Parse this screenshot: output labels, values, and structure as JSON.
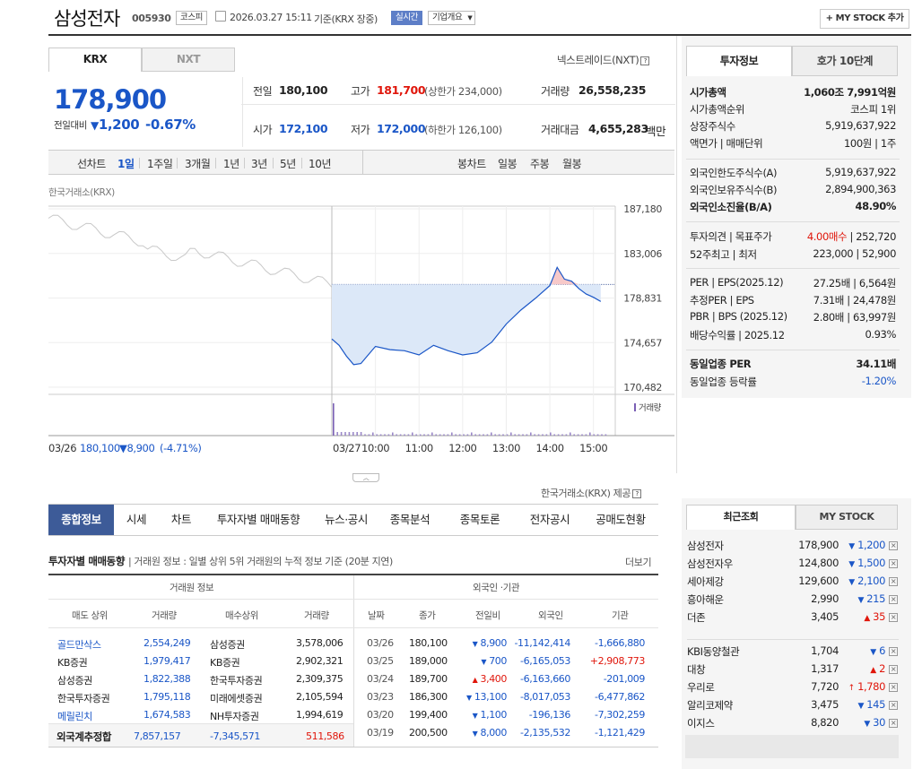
{
  "header": {
    "title": "삼성전자",
    "code": "005930",
    "market_badge": "코스피",
    "datetime": "2026.03.27 15:11",
    "basis": "기준(KRX 장중)",
    "realtime_badge": "실시간",
    "company_overview": "기업개요",
    "my_stock_btn": "+ MY STOCK 추가"
  },
  "market_tabs": {
    "krx": "KRX",
    "nxt": "NXT",
    "nextrade_link": "넥스트레이드(NXT)"
  },
  "quote": {
    "price": "178,900",
    "change_label": "전일대비",
    "change": "1,200",
    "change_pct": "-0.67%",
    "prev_close_label": "전일",
    "prev_close": "180,100",
    "high_label": "고가",
    "high": "181,700",
    "upper_limit": "(상한가 234,000)",
    "volume_label": "거래량",
    "volume": "26,558,235",
    "open_label": "시가",
    "open": "172,100",
    "low_label": "저가",
    "low": "172,000",
    "lower_limit": "(하한가 126,100)",
    "amount_label": "거래대금",
    "amount": "4,655,283",
    "amount_unit": "백만"
  },
  "period_bar": {
    "line_chart": "선차트",
    "periods": [
      "1일",
      "1주일",
      "3개월",
      "1년",
      "3년",
      "5년",
      "10년"
    ],
    "candle_chart": "봉차트",
    "candle_periods": [
      "일봉",
      "주봉",
      "월봉"
    ]
  },
  "chart_data": {
    "type": "line",
    "source_label": "한국거래소(KRX)",
    "y_ticks": [
      "187,180",
      "183,006",
      "178,831",
      "174,657",
      "170,482"
    ],
    "ylim": [
      170482,
      187180
    ],
    "prev_close_ref": 180100,
    "volume_label": "거래량",
    "x_ticks": [
      "03/27",
      "10:00",
      "11:00",
      "12:00",
      "13:00",
      "14:00",
      "15:00"
    ],
    "prev_day_label": "03/26",
    "prev_day_summary": "180,100",
    "prev_day_change": "8,900",
    "prev_day_pct": "(-4.71%)",
    "series": [
      {
        "x": [
          "09:00",
          "09:10",
          "09:20",
          "09:30",
          "09:40",
          "09:50",
          "10:00",
          "10:20",
          "10:40",
          "11:00",
          "11:20",
          "11:40",
          "12:00",
          "12:20",
          "12:40",
          "13:00",
          "13:20",
          "13:40",
          "14:00",
          "14:10",
          "14:20",
          "14:30",
          "14:40",
          "14:50",
          "15:00",
          "15:10"
        ],
        "y": [
          175000,
          174400,
          173400,
          172600,
          172700,
          173500,
          174300,
          174000,
          173900,
          173500,
          174400,
          173900,
          173500,
          173700,
          174700,
          176400,
          177700,
          178800,
          180000,
          181700,
          180600,
          180400,
          179700,
          179200,
          178900,
          178500
        ]
      }
    ]
  },
  "chart_footer": {
    "source": "한국거래소(KRX) 제공"
  },
  "nav_tabs": [
    "종합정보",
    "시세",
    "차트",
    "투자자별 매매동향",
    "뉴스·공시",
    "종목분석",
    "종목토론",
    "전자공시",
    "공매도현황"
  ],
  "trading": {
    "title": "투자자별 매매동향",
    "desc": "거래원 정보 : 일별 상위 5위 거래원의 누적 정보 기준 (20분 지연)",
    "more": "더보기",
    "group_left": "거래원 정보",
    "group_right": "외국인 ·기관",
    "headers": [
      "매도 상위",
      "거래량",
      "매수상위",
      "거래량",
      "날짜",
      "종가",
      "전일비",
      "외국인",
      "기관"
    ],
    "brokers": [
      {
        "sell": "골드만삭스",
        "sell_vol": "2,554,249",
        "buy": "삼성증권",
        "buy_vol": "3,578,006"
      },
      {
        "sell": "KB증권",
        "sell_vol": "1,979,417",
        "buy": "KB증권",
        "buy_vol": "2,902,321"
      },
      {
        "sell": "삼성증권",
        "sell_vol": "1,822,388",
        "buy": "한국투자증권",
        "buy_vol": "2,309,375"
      },
      {
        "sell": "한국투자증권",
        "sell_vol": "1,795,118",
        "buy": "미래에셋증권",
        "buy_vol": "2,105,594"
      },
      {
        "sell": "메릴린치",
        "sell_vol": "1,674,583",
        "buy": "NH투자증권",
        "buy_vol": "1,994,619"
      }
    ],
    "foreign_total": {
      "label": "외국계추정합",
      "sell": "7,857,157",
      "buy": "-7,345,571",
      "net": "511,586"
    },
    "daily": [
      {
        "date": "03/26",
        "close": "180,100",
        "chg": "8,900",
        "dir": "down",
        "foreign": "-11,142,414",
        "inst": "-1,666,880"
      },
      {
        "date": "03/25",
        "close": "189,000",
        "chg": "700",
        "dir": "down",
        "foreign": "-6,165,053",
        "inst": "+2,908,773"
      },
      {
        "date": "03/24",
        "close": "189,700",
        "chg": "3,400",
        "dir": "up",
        "foreign": "-6,163,660",
        "inst": "-201,009"
      },
      {
        "date": "03/23",
        "close": "186,300",
        "chg": "13,100",
        "dir": "down",
        "foreign": "-8,017,053",
        "inst": "-6,477,862"
      },
      {
        "date": "03/20",
        "close": "199,400",
        "chg": "1,100",
        "dir": "down",
        "foreign": "-196,136",
        "inst": "-7,302,259"
      },
      {
        "date": "03/19",
        "close": "200,500",
        "chg": "8,000",
        "dir": "down",
        "foreign": "-2,135,532",
        "inst": "-1,121,429"
      }
    ]
  },
  "side": {
    "tab_invest": "투자정보",
    "tab_hoga": "호가 10단계",
    "market_cap_label": "시가총액",
    "market_cap": "1,060조 7,991억원",
    "cap_rank_label": "시가총액순위",
    "cap_rank": "코스피 1위",
    "shares_label": "상장주식수",
    "shares": "5,919,637,922",
    "par_label": "액면가 | 매매단위",
    "par": "100원 | 1주",
    "foreign_limit_label": "외국인한도주식수(A)",
    "foreign_limit": "5,919,637,922",
    "foreign_hold_label": "외국인보유주식수(B)",
    "foreign_hold": "2,894,900,363",
    "foreign_ratio_label": "외국인소진율(B/A)",
    "foreign_ratio": "48.90%",
    "opinion_label": "투자의견 | 목표주가",
    "opinion": "4.00매수",
    "target": "252,720",
    "week52_label": "52주최고 | 최저",
    "week52": "223,000 | 52,900",
    "per_label": "PER | EPS(2025.12)",
    "per": "27.25배 | 6,564원",
    "est_per_label": "추정PER | EPS",
    "est_per": "7.31배 | 24,478원",
    "pbr_label": "PBR | BPS (2025.12)",
    "pbr": "2.80배 | 63,997원",
    "div_label": "배당수익률 | 2025.12",
    "div": "0.93%",
    "sector_per_label": "동일업종 PER",
    "sector_per": "34.11배",
    "sector_chg_label": "동일업종 등락률",
    "sector_chg": "-1.20%"
  },
  "recent": {
    "tab_recent": "최근조회",
    "tab_mystock": "MY STOCK",
    "items": [
      {
        "name": "삼성전자",
        "price": "178,900",
        "chg": "1,200",
        "dir": "down"
      },
      {
        "name": "삼성전자우",
        "price": "124,800",
        "chg": "1,500",
        "dir": "down"
      },
      {
        "name": "세아제강",
        "price": "129,600",
        "chg": "2,100",
        "dir": "down"
      },
      {
        "name": "흥아해운",
        "price": "2,990",
        "chg": "215",
        "dir": "down"
      },
      {
        "name": "더존",
        "price": "3,405",
        "chg": "35",
        "dir": "up"
      },
      {
        "name": "KBI동양철관",
        "price": "1,704",
        "chg": "6",
        "dir": "down"
      },
      {
        "name": "대창",
        "price": "1,317",
        "chg": "2",
        "dir": "up"
      },
      {
        "name": "우리로",
        "price": "7,720",
        "chg": "1,780",
        "dir": "upper"
      },
      {
        "name": "알리코제약",
        "price": "3,475",
        "chg": "145",
        "dir": "down"
      },
      {
        "name": "이지스",
        "price": "8,820",
        "chg": "30",
        "dir": "down"
      }
    ]
  },
  "colors": {
    "up": "#e0160b",
    "down": "#1a56c7",
    "nav_active": "#3d5b98"
  }
}
